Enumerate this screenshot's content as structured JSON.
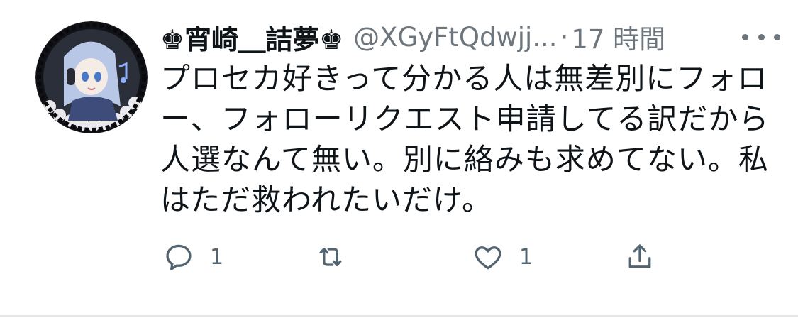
{
  "tweet": {
    "display_name": "♚宵崎＿詰夢♚",
    "handle": "@XGyFtQdwjj...",
    "separator": "·",
    "time": "17 時間",
    "text": "プロセカ好きって分かる人は無差別にフォロー、フォローリクエスト申請してる訳だから人選なんて無い。別に絡みも求めてない。私はただ救われたいだけ。"
  },
  "actions": {
    "reply_count": "1",
    "retweet_count": "",
    "like_count": "1"
  },
  "icons": {
    "more": "more-horizontal-icon",
    "reply": "reply-icon",
    "retweet": "retweet-icon",
    "like": "heart-icon",
    "share": "share-icon"
  },
  "colors": {
    "text_primary": "#0f1419",
    "text_secondary": "#6e767d",
    "icon": "#536471"
  }
}
